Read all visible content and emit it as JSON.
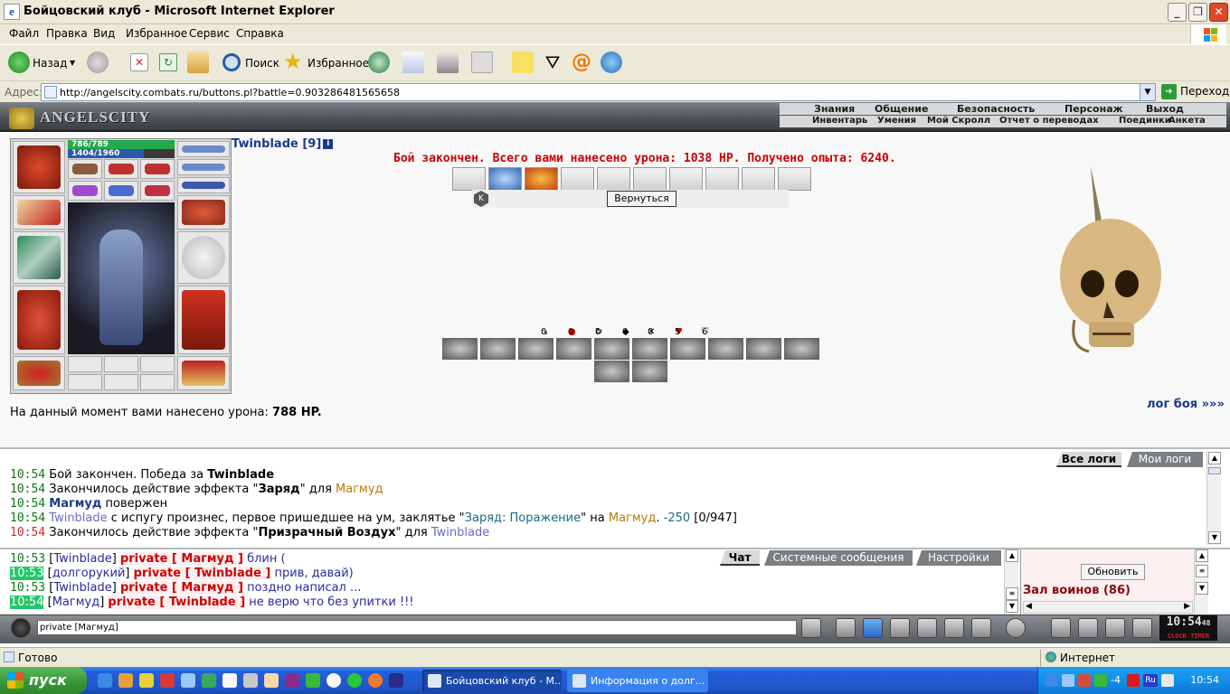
{
  "window": {
    "title": "Бойцовский клуб - Microsoft Internet Explorer"
  },
  "menu": [
    "Файл",
    "Правка",
    "Вид",
    "Избранное",
    "Сервис",
    "Справка"
  ],
  "toolbar": {
    "back_label": "Назад",
    "search_label": "Поиск",
    "favorites_label": "Избранное"
  },
  "address": {
    "label": "Адрес:",
    "url": "http://angelscity.combats.ru/buttons.pl?battle=0.903286481565658",
    "go_label": "Переход"
  },
  "game": {
    "logo": "ANGELSCITY",
    "nav_top": [
      "Знания",
      "Общение",
      "Безопасность",
      "Персонаж",
      "Выход"
    ],
    "nav_sub": [
      "Инвентарь",
      "Умения",
      "Мой Скролл",
      "Отчет о переводах",
      "Поединки",
      "Анкета"
    ],
    "char": {
      "hp": "786/789",
      "mana": "1404/1960",
      "hp_fraction": 0.996,
      "mana_fraction": 0.716
    },
    "player_name": "Twinblade [9]",
    "battle_message": "Бой закончен. Всего вами нанесено урона: 1038 HP. Получено опыта: 6240.",
    "return_button": "Вернуться",
    "stats": [
      "0",
      "0",
      "0",
      "0",
      "0",
      "5",
      "6"
    ],
    "damage_now_prefix": "На данный момент вами нанесено урона:",
    "damage_now_value": "788 HP.",
    "log_link": "лог боя »»»"
  },
  "log": {
    "tabs": [
      "Все логи",
      "Мои логи"
    ],
    "lines": [
      {
        "time": "10:54",
        "parts": [
          "Бой закончен. Победа за ",
          "Twinblade",
          ""
        ]
      },
      {
        "time": "10:54",
        "parts": [
          "Закончилось действие эффекта \"",
          "Заряд",
          "\" для ",
          "Магмуд"
        ]
      },
      {
        "time": "10:54",
        "parts": [
          "Магмуд",
          " повержен"
        ]
      },
      {
        "time": "10:54",
        "parts": [
          "Twinblade",
          " с испугу произнес, первое пришедшее на ум, заклятье \"",
          "Заряд: Поражение",
          "\" на ",
          "Магмуд",
          ". ",
          "-250",
          " [0/947]"
        ]
      },
      {
        "time": "10:54",
        "parts": [
          "Закончилось действие эффекта \"",
          "Призрачный Воздух",
          "\" для ",
          "Twinblade"
        ]
      }
    ]
  },
  "chat": {
    "tabs": [
      "Чат",
      "Системные сообщения",
      "Настройки"
    ],
    "lines": [
      {
        "time": "10:53",
        "nick": "Twinblade",
        "to": "private [ Магмуд ]",
        "text": "блин (",
        "hl": false
      },
      {
        "time": "10:53",
        "nick": "долгорукий",
        "to": "private [ Twinblade ]",
        "text": "прив, давай)",
        "hl": true
      },
      {
        "time": "10:53",
        "nick": "Twinblade",
        "to": "private [ Магмуд ]",
        "text": "поздно написал ...",
        "hl": false
      },
      {
        "time": "10:54",
        "nick": "Магмуд",
        "to": "private [ Twinblade ]",
        "text": "не верю что без упитки !!!",
        "hl": true
      }
    ],
    "refresh": "Обновить",
    "hall": "Зал воинов (86)",
    "input_value": "private [Магмуд]",
    "clock_time": "10:54",
    "clock_sec": "48",
    "clock_labels": "CLOCK TIMER"
  },
  "status": {
    "text": "Готово",
    "zone": "Интернет"
  },
  "taskbar": {
    "start": "пуск",
    "tasks": [
      "Бойцовский клуб - М...",
      "Информация о долг..."
    ],
    "tray_time": "10:54",
    "tray_num": "-4"
  },
  "colors": {
    "accent_red": "#cc0000",
    "nick_blue": "#1a3a8a",
    "magmud": "#b87a00",
    "twinblade": "#6a6aca"
  }
}
